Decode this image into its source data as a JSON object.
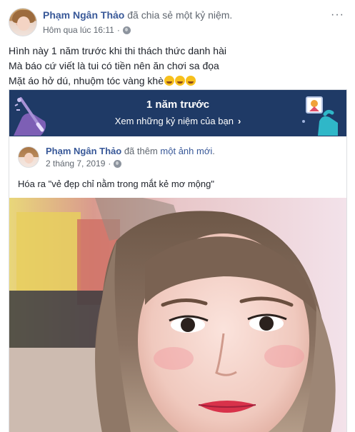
{
  "post": {
    "author_name": "Phạm Ngân Thảo",
    "action_text": "đã chia sẻ một kỷ niệm.",
    "timestamp": "Hôm qua lúc 16:11",
    "privacy_icon": "globe-icon",
    "more_label": "···",
    "caption_lines": [
      "Hình này 1 năm trước khi thi thách thức danh hài",
      "Mà báo cứ viết là tui có tiền nên ăn chơi sa đọa",
      "Mặt áo hở dú, nhuộm tóc vàng khè"
    ],
    "caption_emoji": "grinning-tears-emoji"
  },
  "memory": {
    "banner_title": "1 năm trước",
    "banner_subtitle": "Xem những kỷ niệm của bạn",
    "banner_color": "#1f3a66",
    "original_post": {
      "author_name": "Phạm Ngân Thảo",
      "action_prefix": "đã thêm",
      "action_link": "một ảnh mới",
      "action_suffix": ".",
      "date": "2 tháng 7, 2019",
      "privacy_icon": "globe-icon",
      "text": "Hóa ra \"vẻ đẹp chỉ nằm trong mắt kẻ mơ mộng\""
    }
  },
  "colors": {
    "link": "#385898",
    "secondary_text": "#606770",
    "primary_text": "#1d2129"
  }
}
